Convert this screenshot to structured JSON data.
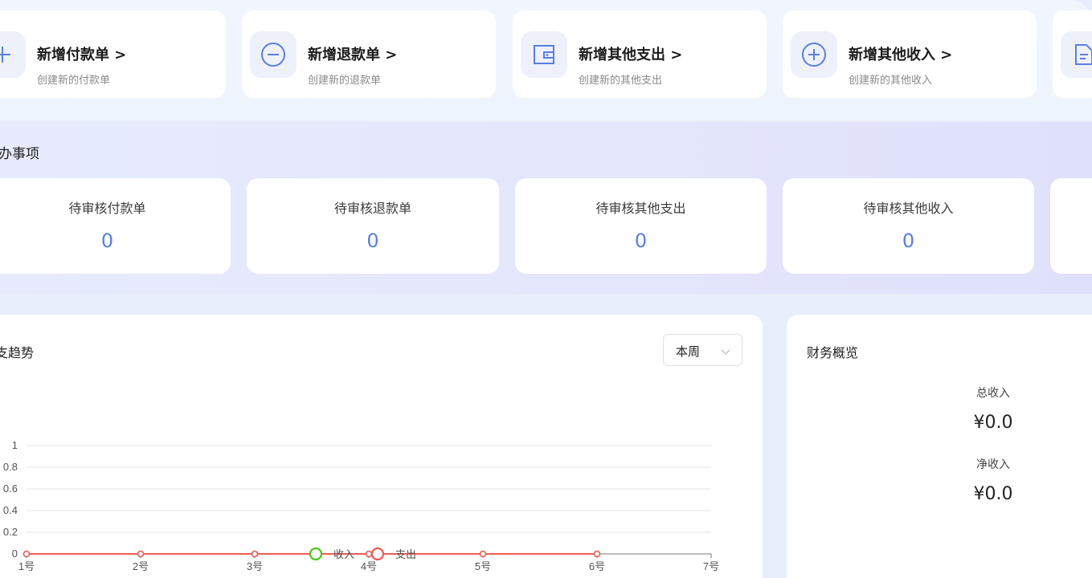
{
  "quick_actions": [
    {
      "title": "新增付款单 >",
      "subtitle": "创建新的付款单",
      "icon": "plus-icon"
    },
    {
      "title": "新增退款单 >",
      "subtitle": "创建新的退款单",
      "icon": "minus-circle-icon"
    },
    {
      "title": "新增其他支出 >",
      "subtitle": "创建新的其他支出",
      "icon": "wallet-icon"
    },
    {
      "title": "新增其他收入 >",
      "subtitle": "创建新的其他收入",
      "icon": "plus-circle-icon"
    },
    {
      "title": "",
      "subtitle": "",
      "icon": "document-icon"
    }
  ],
  "todo": {
    "title": "办事项",
    "items": [
      {
        "label": "待审核付款单",
        "value": "0"
      },
      {
        "label": "待审核退款单",
        "value": "0"
      },
      {
        "label": "待审核其他支出",
        "value": "0"
      },
      {
        "label": "待审核其他收入",
        "value": "0"
      }
    ]
  },
  "trend": {
    "title": "支趋势",
    "period": "本周"
  },
  "overview": {
    "title": "财务概览",
    "total_income_label": "总收入",
    "total_income_value": "¥0.0",
    "net_income_label": "净收入",
    "net_income_value": "¥0.0"
  },
  "colors": {
    "accent": "#5b7fe0",
    "income": "#52c41a",
    "expense": "#ee5b57"
  },
  "chart_data": {
    "type": "line",
    "categories": [
      "1号",
      "2号",
      "3号",
      "4号",
      "5号",
      "6号",
      "7号"
    ],
    "series": [
      {
        "name": "收入",
        "values": [
          0,
          0,
          0,
          0,
          0,
          0
        ]
      },
      {
        "name": "支出",
        "values": [
          0,
          0,
          0,
          0,
          0,
          0
        ]
      }
    ],
    "yticks": [
      "0",
      "0.2",
      "0.4",
      "0.6",
      "0.8",
      "1"
    ],
    "ylim": [
      0,
      1
    ],
    "grid": true,
    "legend": "bottom-center"
  }
}
